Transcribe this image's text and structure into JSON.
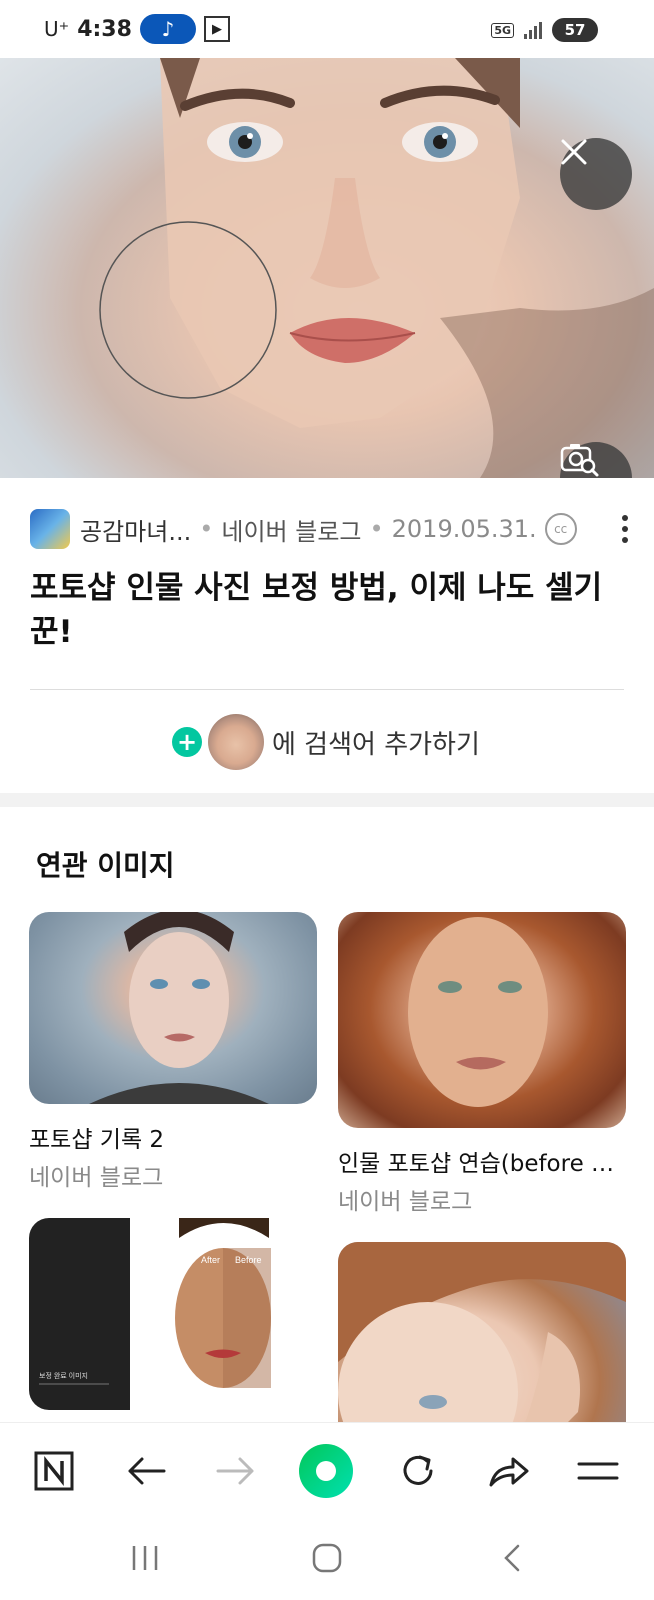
{
  "status_bar": {
    "carrier": "U⁺",
    "time": "4:38",
    "music_symbol": "♪",
    "network": "5G",
    "battery": "57"
  },
  "source": {
    "author": "공감마녀...",
    "site": "네이버 블로그",
    "date": "2019.05.31.",
    "cc_label": "cc"
  },
  "article_title": "포토샵 인물 사진 보정 방법, 이제 나도 셀기꾼!",
  "add_search": {
    "plus": "+",
    "text": "에 검색어 추가하기"
  },
  "related": {
    "heading": "연관 이미지",
    "items": [
      {
        "title": "포토샵 기록 2",
        "source": "네이버 블로그"
      },
      {
        "title": "인물 포토샵 연습(before & ...",
        "source": "네이버 블로그"
      },
      {
        "title": "",
        "source": ""
      },
      {
        "title": "",
        "source": ""
      }
    ],
    "card3_caption": "보정 완료 이미지",
    "card3_after_label": "After",
    "card3_before_label": "Before"
  },
  "nav_icons": [
    "naver-home-icon",
    "back-icon",
    "forward-icon",
    "green-dot-icon",
    "reload-icon",
    "share-icon",
    "menu-icon"
  ],
  "colors": {
    "accent_green": "#03c75a",
    "teal_plus": "#03c7a0",
    "music_pill": "#0b57b8"
  }
}
